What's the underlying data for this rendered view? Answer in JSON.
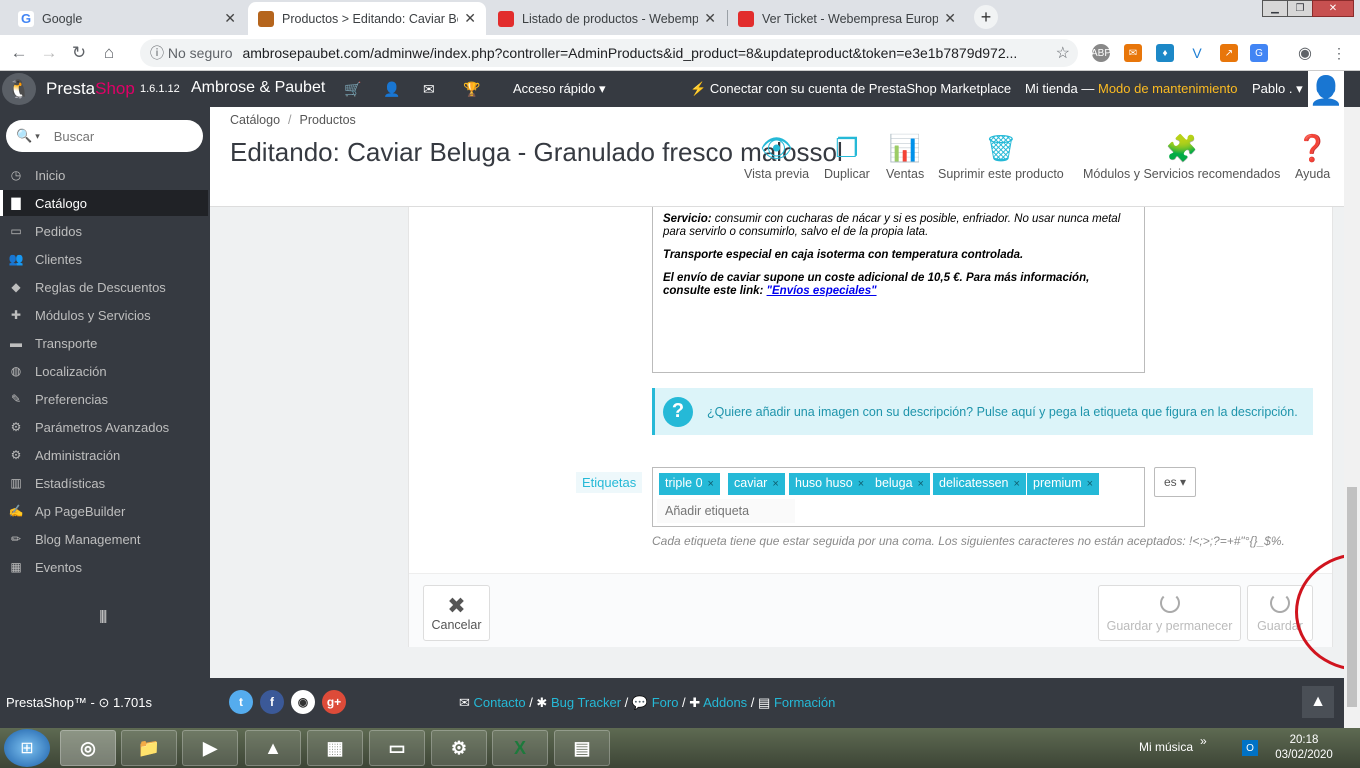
{
  "browser": {
    "tabs": [
      {
        "title": "Google",
        "favicon_color": "#4285f4"
      },
      {
        "title": "Productos > Editando: Caviar Bel",
        "favicon_color": "#b5651d"
      },
      {
        "title": "Listado de productos - Webemp",
        "favicon_color": "#e22d2d"
      },
      {
        "title": "Ver Ticket - Webempresa Europa",
        "favicon_color": "#e22d2d"
      }
    ],
    "new_tab": "+",
    "security_label": "No seguro",
    "url": "ambrosepaubet.com/adminwe/index.php?controller=AdminProducts&id_product=8&updateproduct&token=e3e1b7879d972..."
  },
  "ps_header": {
    "brand_main": "Presta",
    "brand_accent": "Shop",
    "version": "1.6.1.12",
    "shop_name": "Ambrose & Paubet",
    "quick_access": "Acceso rápido",
    "marketplace": "Conectar con su cuenta de PrestaShop Marketplace",
    "my_store": "Mi tienda",
    "maintenance": "Modo de mantenimiento",
    "employee": "Pablo ."
  },
  "sidebar": {
    "search_placeholder": "Buscar",
    "items": [
      {
        "label": "Inicio",
        "icon": "tachometer-icon"
      },
      {
        "label": "Catálogo",
        "icon": "book-icon"
      },
      {
        "label": "Pedidos",
        "icon": "credit-card-icon"
      },
      {
        "label": "Clientes",
        "icon": "users-icon"
      },
      {
        "label": "Reglas de Descuentos",
        "icon": "tags-icon"
      },
      {
        "label": "Módulos y Servicios",
        "icon": "puzzle-icon"
      },
      {
        "label": "Transporte",
        "icon": "truck-icon"
      },
      {
        "label": "Localización",
        "icon": "globe-icon"
      },
      {
        "label": "Preferencias",
        "icon": "wrench-icon"
      },
      {
        "label": "Parámetros Avanzados",
        "icon": "cogs-icon"
      },
      {
        "label": "Administración",
        "icon": "cog-icon"
      },
      {
        "label": "Estadísticas",
        "icon": "bar-chart-icon"
      },
      {
        "label": "Ap PageBuilder",
        "icon": "edit-icon"
      },
      {
        "label": "Blog Management",
        "icon": "pencil-icon"
      },
      {
        "label": "Eventos",
        "icon": "calendar-icon"
      }
    ],
    "active_index": 1
  },
  "page_head": {
    "breadcrumb": [
      "Catálogo",
      "Productos"
    ],
    "title": "Editando: Caviar Beluga - Granulado fresco malossol",
    "toolbar": [
      {
        "label": "Vista previa",
        "icon": "eye-icon"
      },
      {
        "label": "Duplicar",
        "icon": "copy-icon"
      },
      {
        "label": "Ventas",
        "icon": "bar-chart-icon"
      },
      {
        "label": "Suprimir este producto",
        "icon": "trash-icon"
      },
      {
        "label": "Módulos y Servicios recomendados",
        "icon": "puzzle-icon"
      },
      {
        "label": "Ayuda",
        "icon": "question-icon"
      }
    ]
  },
  "description": {
    "service_label": "Servicio:",
    "service_text": "consumir con cucharas de nácar y si es posible, enfriador. No usar nunca metal para servirlo o consumirlo, salvo el de la propia lata.",
    "transport_text": "Transporte especial en caja isoterma con temperatura controlada.",
    "shipping_text": "El envío de caviar supone un coste adicional de 10,5 €. Para más información, consulte este link:",
    "shipping_link": "\"Envíos especiales\""
  },
  "info_alert": {
    "text": "¿Quiere añadir una imagen con su descripción?",
    "link_text": "Pulse aquí y pega la etiqueta que figura en la descripción."
  },
  "tags": {
    "label": "Etiquetas",
    "items": [
      "triple 0",
      "caviar",
      "huso huso",
      "beluga",
      "delicatessen",
      "premium"
    ],
    "remove_symbol": "×",
    "add_placeholder": "Añadir etiqueta",
    "language": "es",
    "help": "Cada etiqueta tiene que estar seguida por una coma. Los siguientes caracteres no están aceptados: !<;>;?=+#\"°{}_$%."
  },
  "footer_buttons": {
    "cancel": "Cancelar",
    "save_stay": "Guardar y permanecer",
    "save": "Guardar"
  },
  "ps_footer": {
    "left": "PrestaShop™ - ⊙ 1.701s",
    "links": [
      "Contacto",
      "Bug Tracker",
      "Foro",
      "Addons",
      "Formación"
    ]
  },
  "taskbar": {
    "media": "Mi música",
    "time": "20:18",
    "date": "03/02/2020"
  }
}
